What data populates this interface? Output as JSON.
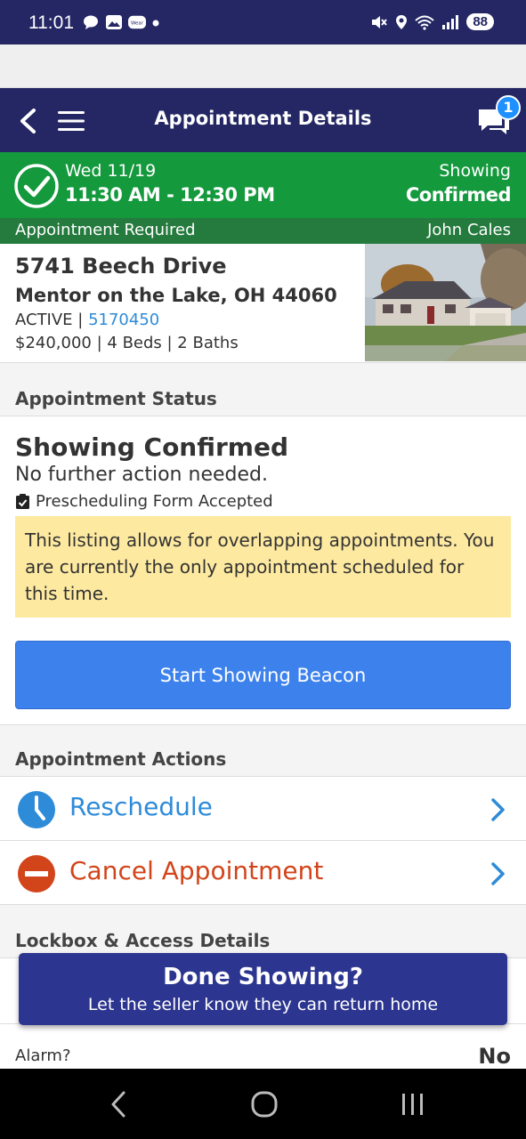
{
  "status_bar": {
    "time": "11:01",
    "battery": "88"
  },
  "header": {
    "title": "Appointment Details",
    "chat_badge": "1"
  },
  "confirmation": {
    "date": "Wed 11/19",
    "time_range": "11:30 AM - 12:30 PM",
    "label": "Showing",
    "status": "Confirmed",
    "requirement": "Appointment Required",
    "agent": "John Cales"
  },
  "listing": {
    "address_line1": "5741 Beech Drive",
    "address_line2": "Mentor on the Lake, OH 44060",
    "status": "ACTIVE",
    "separator": " | ",
    "mls_number": "5170450",
    "details": "$240,000 | 4 Beds | 2 Baths"
  },
  "appointment_status": {
    "section_title": "Appointment Status",
    "headline": "Showing Confirmed",
    "subtext": "No further action needed.",
    "form_status": "Prescheduling Form Accepted",
    "notice": "This listing allows for overlapping appointments. You are currently the only appointment scheduled for this time.",
    "beacon_button": "Start Showing Beacon"
  },
  "appointment_actions": {
    "section_title": "Appointment Actions",
    "reschedule": "Reschedule",
    "cancel": "Cancel Appointment"
  },
  "lockbox": {
    "section_title": "Lockbox & Access Details",
    "alarm_label": "Alarm?",
    "alarm_value": "No"
  },
  "done_banner": {
    "title": "Done Showing?",
    "subtitle": "Let the seller know they can return home"
  },
  "colors": {
    "header": "#242764",
    "confirm_green": "#14993d",
    "link_blue": "#2e8bd8",
    "cancel_orange": "#d2441a",
    "button_blue": "#3d82ec",
    "notice_yellow": "#fde9a0"
  }
}
